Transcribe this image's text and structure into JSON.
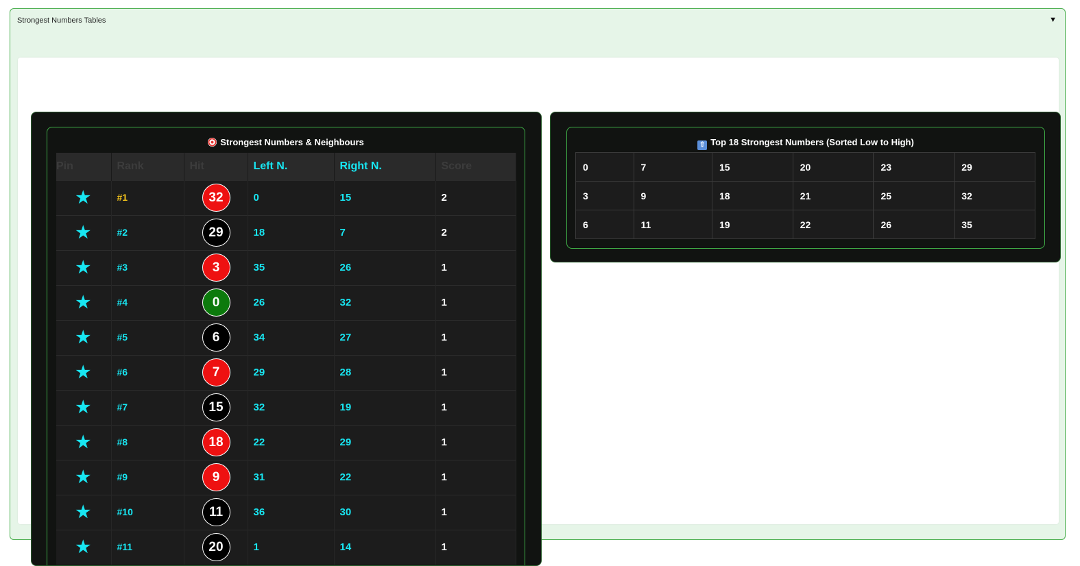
{
  "accordion": {
    "title": "Strongest Numbers Tables",
    "arrow": "▼"
  },
  "left_panel": {
    "title": "Strongest Numbers & Neighbours",
    "columns": {
      "pin": "Pin",
      "rank": "Rank",
      "hit": "Hit",
      "left": "Left N.",
      "right": "Right N.",
      "score": "Score"
    },
    "star_glyph": "★",
    "rows": [
      {
        "rank": "#1",
        "hit": "32",
        "color": "red",
        "left": "0",
        "right": "15",
        "score": "2"
      },
      {
        "rank": "#2",
        "hit": "29",
        "color": "black",
        "left": "18",
        "right": "7",
        "score": "2"
      },
      {
        "rank": "#3",
        "hit": "3",
        "color": "red",
        "left": "35",
        "right": "26",
        "score": "1"
      },
      {
        "rank": "#4",
        "hit": "0",
        "color": "green",
        "left": "26",
        "right": "32",
        "score": "1"
      },
      {
        "rank": "#5",
        "hit": "6",
        "color": "black",
        "left": "34",
        "right": "27",
        "score": "1"
      },
      {
        "rank": "#6",
        "hit": "7",
        "color": "red",
        "left": "29",
        "right": "28",
        "score": "1"
      },
      {
        "rank": "#7",
        "hit": "15",
        "color": "black",
        "left": "32",
        "right": "19",
        "score": "1"
      },
      {
        "rank": "#8",
        "hit": "18",
        "color": "red",
        "left": "22",
        "right": "29",
        "score": "1"
      },
      {
        "rank": "#9",
        "hit": "9",
        "color": "red",
        "left": "31",
        "right": "22",
        "score": "1"
      },
      {
        "rank": "#10",
        "hit": "11",
        "color": "black",
        "left": "36",
        "right": "30",
        "score": "1"
      },
      {
        "rank": "#11",
        "hit": "20",
        "color": "black",
        "left": "1",
        "right": "14",
        "score": "1"
      }
    ]
  },
  "right_panel": {
    "title": "Top 18 Strongest Numbers (Sorted Low to High)",
    "grid": [
      [
        "0",
        "7",
        "15",
        "20",
        "23",
        "29"
      ],
      [
        "3",
        "9",
        "18",
        "21",
        "25",
        "32"
      ],
      [
        "6",
        "11",
        "19",
        "22",
        "26",
        "35"
      ]
    ]
  },
  "colors": {
    "accent_cyan": "#18e6f2",
    "gold": "#f2c21b",
    "red": "#ee1111",
    "green": "#0c7a0c",
    "border_green": "#3fae47"
  }
}
